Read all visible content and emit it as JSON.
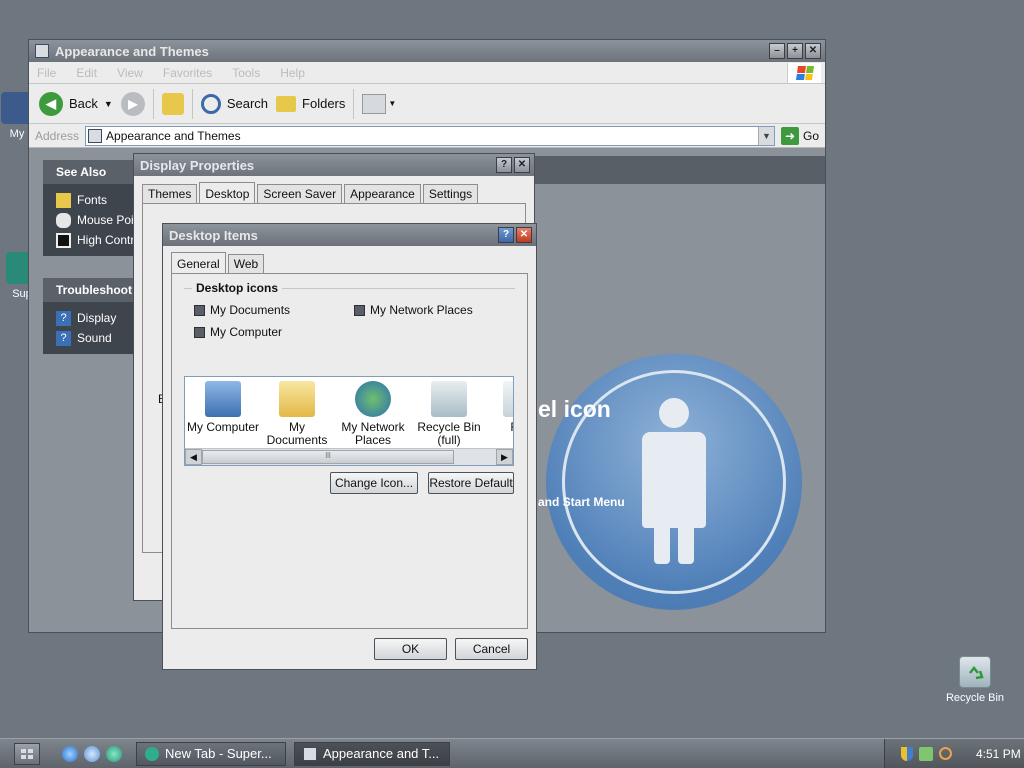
{
  "desktop": {
    "icons": [
      {
        "label": "My"
      },
      {
        "label": "Sup"
      },
      {
        "label": "Recycle Bin"
      }
    ]
  },
  "explorer": {
    "title": "Appearance and Themes",
    "menu": [
      "File",
      "Edit",
      "View",
      "Favorites",
      "Tools",
      "Help"
    ],
    "toolbar": {
      "back": "Back",
      "search": "Search",
      "folders": "Folders"
    },
    "address": {
      "label": "Address",
      "value": "Appearance and Themes",
      "go": "Go"
    },
    "see_also": {
      "title": "See Also",
      "items": [
        "Fonts",
        "Mouse Poir",
        "High Contra"
      ]
    },
    "troubleshoot": {
      "title": "Troubleshoot",
      "items": [
        "Display",
        "Sound"
      ]
    },
    "panel_title": "el icon",
    "panel_subtitle": "and Start Menu",
    "partial_label": "B"
  },
  "display_properties": {
    "title": "Display Properties",
    "tabs": [
      "Themes",
      "Desktop",
      "Screen Saver",
      "Appearance",
      "Settings"
    ],
    "active_tab": "Desktop"
  },
  "desktop_items": {
    "title": "Desktop Items",
    "tabs": [
      "General",
      "Web"
    ],
    "active_tab": "General",
    "group_title": "Desktop icons",
    "checkboxes": {
      "my_documents": "My Documents",
      "my_network_places": "My Network Places",
      "my_computer": "My Computer"
    },
    "icon_list": [
      {
        "line1": "My Computer",
        "line2": ""
      },
      {
        "line1": "My Documents",
        "line2": ""
      },
      {
        "line1": "My Network",
        "line2": "Places"
      },
      {
        "line1": "Recycle Bin",
        "line2": "(full)"
      },
      {
        "line1": "Rec",
        "line2": "(e"
      }
    ],
    "scroll_thumb": "lll",
    "change_icon": "Change Icon...",
    "restore_default": "Restore Default",
    "ok": "OK",
    "cancel": "Cancel"
  },
  "taskbar": {
    "tasks": [
      "New Tab - Super...",
      "Appearance and T..."
    ],
    "clock": "4:51 PM"
  },
  "colors": {
    "desktop_bg": "#6e7680",
    "accent_blue": "#4f7fb8",
    "close_red": "#c23a1e"
  }
}
